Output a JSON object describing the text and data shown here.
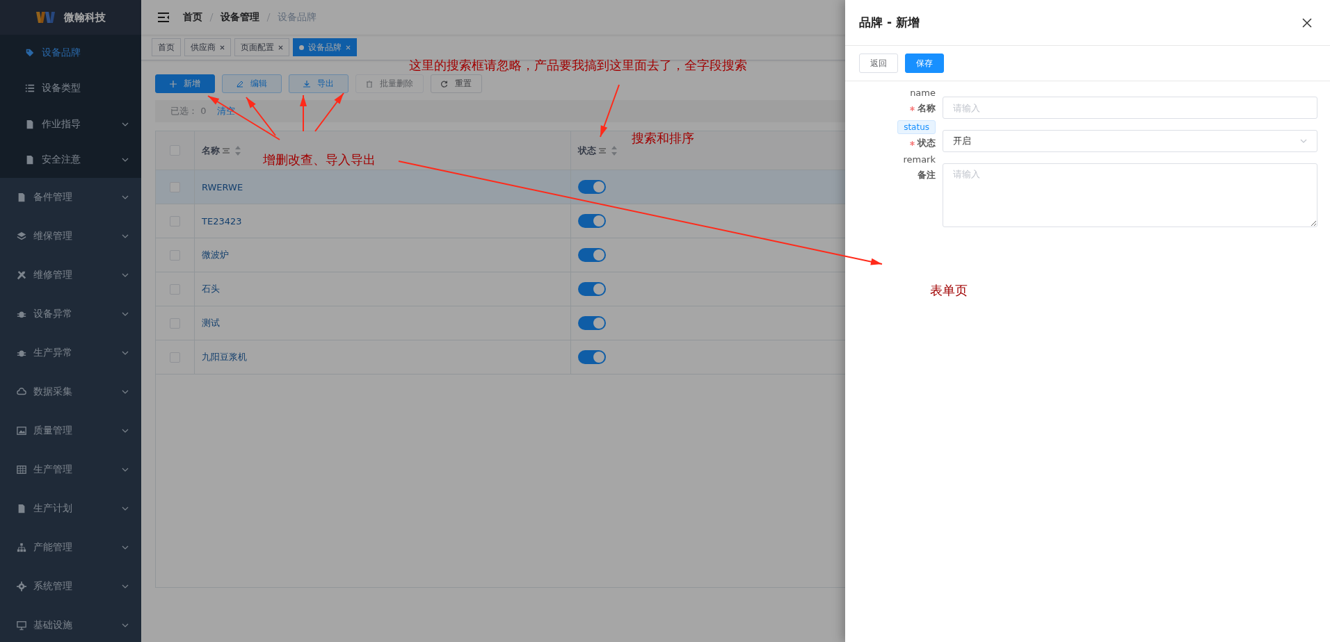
{
  "sidebar": {
    "brand": "微翰科技",
    "sub_items": [
      {
        "label": "设备品牌",
        "selected": true,
        "has_children": false
      },
      {
        "label": "设备类型",
        "selected": false,
        "has_children": false
      },
      {
        "label": "作业指导",
        "selected": false,
        "has_children": true
      },
      {
        "label": "安全注意",
        "selected": false,
        "has_children": true
      }
    ],
    "items": [
      {
        "label": "备件管理",
        "has_children": true
      },
      {
        "label": "维保管理",
        "has_children": true
      },
      {
        "label": "维修管理",
        "has_children": true
      },
      {
        "label": "设备异常",
        "has_children": true
      },
      {
        "label": "生产异常",
        "has_children": true
      },
      {
        "label": "数据采集",
        "has_children": true
      },
      {
        "label": "质量管理",
        "has_children": true
      },
      {
        "label": "生产管理",
        "has_children": true
      },
      {
        "label": "生产计划",
        "has_children": true
      },
      {
        "label": "产能管理",
        "has_children": true
      },
      {
        "label": "系统管理",
        "has_children": true
      },
      {
        "label": "基础设施",
        "has_children": true
      }
    ]
  },
  "breadcrumb": [
    "首页",
    "设备管理",
    "设备品牌"
  ],
  "tabs": [
    {
      "label": "首页",
      "selected": false,
      "closable": false
    },
    {
      "label": "供应商",
      "selected": false,
      "closable": true
    },
    {
      "label": "页面配置",
      "selected": false,
      "closable": true
    },
    {
      "label": "设备品牌",
      "selected": true,
      "closable": true
    }
  ],
  "toolbar": [
    {
      "label": "新增",
      "kind": "primary",
      "disabled": false
    },
    {
      "label": "编辑",
      "kind": "edit",
      "disabled": false
    },
    {
      "label": "导出",
      "kind": "export",
      "disabled": false
    },
    {
      "label": "批量删除",
      "kind": "delete",
      "disabled": true
    },
    {
      "label": "重置",
      "kind": "reset",
      "disabled": false
    }
  ],
  "selection": {
    "label": "已选：",
    "count": "0",
    "clear": "清空"
  },
  "table": {
    "select_all_checked": false,
    "columns": [
      {
        "label": "名称"
      },
      {
        "label": "状态"
      }
    ],
    "rows": [
      {
        "name": "RWERWE",
        "on": true,
        "checked": false,
        "hovered": true
      },
      {
        "name": "TE23423",
        "on": true,
        "checked": false,
        "hovered": false
      },
      {
        "name": "微波炉",
        "on": true,
        "checked": false,
        "hovered": false
      },
      {
        "name": "石头",
        "on": true,
        "checked": false,
        "hovered": false
      },
      {
        "name": "测试",
        "on": true,
        "checked": false,
        "hovered": false
      },
      {
        "name": "九阳豆浆机",
        "on": true,
        "checked": false,
        "hovered": false
      }
    ]
  },
  "drawer": {
    "title": "品牌 - 新增",
    "buttons": [
      {
        "label": "返回",
        "kind": "default"
      },
      {
        "label": "保存",
        "kind": "primary"
      }
    ],
    "fields": [
      {
        "hint": {
          "text": "name",
          "kind": "plain"
        },
        "required": true,
        "label": "名称",
        "kind": "input",
        "placeholder": "请输入"
      },
      {
        "hint": {
          "text": "status",
          "kind": "tag"
        },
        "required": true,
        "label": "状态",
        "kind": "select",
        "value": "开启"
      },
      {
        "hint": {
          "text": "remark",
          "kind": "plain"
        },
        "required": false,
        "label": "备注",
        "kind": "textarea",
        "placeholder": "请输入"
      }
    ]
  },
  "annotations": [
    "这里的搜索框请忽略，产品要我搞到这里面去了，全字段搜索",
    "增删改查、导入导出",
    "搜索和排序",
    "表单页"
  ]
}
